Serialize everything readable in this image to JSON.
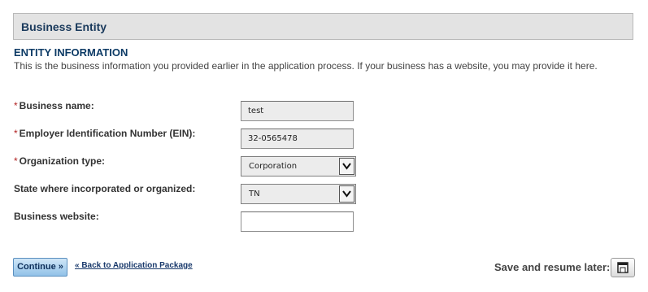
{
  "header": {
    "title": "Business Entity"
  },
  "section": {
    "title": "ENTITY INFORMATION",
    "description": "This is the business information you provided earlier in the application process. If your business has a website, you may provide it here."
  },
  "fields": {
    "business_name": {
      "required_mark": "*",
      "label": "Business name:",
      "value": "test"
    },
    "ein": {
      "required_mark": "*",
      "label": "Employer Identification Number (EIN):",
      "value": "32-0565478"
    },
    "organization_type": {
      "required_mark": "*",
      "label": "Organization type:",
      "selected": "Corporation"
    },
    "state": {
      "label": "State where incorporated or organized:",
      "selected": "TN"
    },
    "website": {
      "label": "Business website:",
      "value": ""
    }
  },
  "actions": {
    "continue_label": "Continue »",
    "back_link": "« Back to Application Package",
    "save_label": "Save and resume later:"
  },
  "icons": {
    "select_arrow": "chevron-down-icon",
    "save": "floppy-disk-icon"
  }
}
